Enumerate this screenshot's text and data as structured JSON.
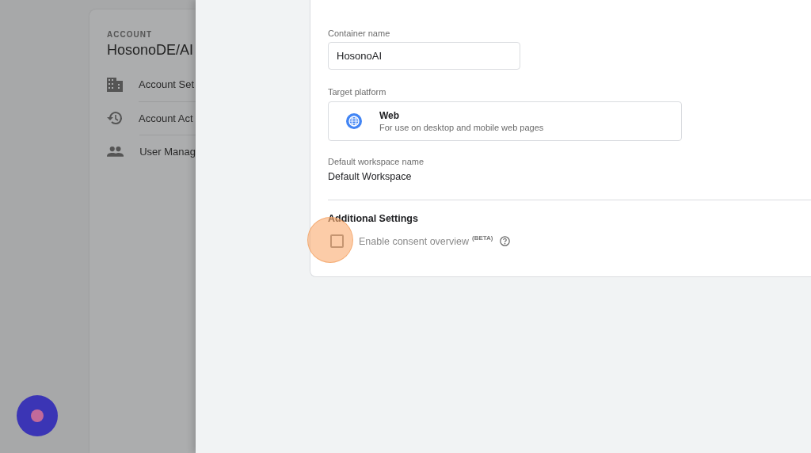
{
  "account": {
    "overline": "ACCOUNT",
    "name": "HosonoDE/AI",
    "menu": [
      {
        "kind": "building",
        "label": "Account Set"
      },
      {
        "kind": "history",
        "label": "Account Act"
      },
      {
        "kind": "people",
        "label": "User Manag"
      }
    ]
  },
  "container_form": {
    "name_label": "Container name",
    "name_value": "HosonoAI",
    "platform_label": "Target platform",
    "platform": {
      "title": "Web",
      "description": "For use on desktop and mobile web pages"
    },
    "workspace_label": "Default workspace name",
    "workspace_value": "Default Workspace",
    "additional_heading": "Additional Settings",
    "consent": {
      "label": "Enable consent overview",
      "badge": "(BETA)",
      "checked": false
    }
  }
}
